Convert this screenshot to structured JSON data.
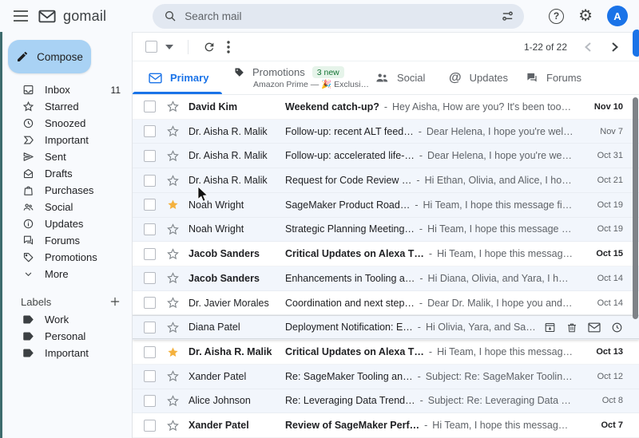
{
  "topbar": {
    "app_name": "gomail",
    "search_placeholder": "Search mail",
    "help_glyph": "?",
    "gear_glyph": "⚙",
    "avatar_letter": "A"
  },
  "toolbar": {
    "pagination": "1-22 of 22"
  },
  "sidebar": {
    "compose_label": "Compose",
    "items": [
      {
        "label": "Inbox",
        "count": "11",
        "icon": "inbox-icon"
      },
      {
        "label": "Starred",
        "icon": "star-icon"
      },
      {
        "label": "Snoozed",
        "icon": "clock-icon"
      },
      {
        "label": "Important",
        "icon": "important-icon"
      },
      {
        "label": "Sent",
        "icon": "send-icon"
      },
      {
        "label": "Drafts",
        "icon": "draft-icon"
      },
      {
        "label": "Purchases",
        "icon": "shopping-bag-icon"
      },
      {
        "label": "Social",
        "icon": "people-icon"
      },
      {
        "label": "Updates",
        "icon": "info-icon"
      },
      {
        "label": "Forums",
        "icon": "chat-icon"
      },
      {
        "label": "Promotions",
        "icon": "tag-icon"
      },
      {
        "label": "More",
        "icon": "chevron-down-icon"
      }
    ],
    "labels_header": "Labels",
    "labels": [
      "Work",
      "Personal",
      "Important"
    ]
  },
  "tabs": [
    {
      "label": "Primary",
      "active": true,
      "icon": "envelope-icon"
    },
    {
      "label": "Promotions",
      "badge": "3 new",
      "subtitle": "Amazon Prime — 🎉 Exclusi…",
      "icon": "tag-icon"
    },
    {
      "label": "Social",
      "icon": "people-icon"
    },
    {
      "label": "Updates",
      "icon_glyph": "@"
    },
    {
      "label": "Forums",
      "icon": "chat-icon"
    }
  ],
  "list": {
    "separator": "-"
  },
  "hover_actions": [
    "archive-icon",
    "trash-icon",
    "envelope-icon",
    "clock-icon"
  ],
  "emails": [
    {
      "sender": "David Kim",
      "subject": "Weekend catch-up?",
      "snippet": "Hey Aisha, How are you? It's been too long — I kee…",
      "date": "Nov 10",
      "unread": true,
      "starred": false,
      "tinted": false
    },
    {
      "sender": "Dr. Aisha R. Malik",
      "subject": "Follow-up: recent ALT feed…",
      "snippet": "Dear Helena, I hope you're well — and th…",
      "date": "Nov 7",
      "unread": false,
      "starred": false,
      "tinted": true
    },
    {
      "sender": "Dr. Aisha R. Malik",
      "subject": "Follow-up: accelerated life-…",
      "snippet": "Dear Helena, I hope you're well. Thank y…",
      "date": "Oct 31",
      "unread": false,
      "starred": false,
      "tinted": true
    },
    {
      "sender": "Dr. Aisha R. Malik",
      "subject": "Request for Code Review …",
      "snippet": "Hi Ethan, Olivia, and Alice, I hope this me…",
      "date": "Oct 21",
      "unread": false,
      "starred": false,
      "tinted": true
    },
    {
      "sender": "Noah Wright",
      "subject": "SageMaker Product Road…",
      "snippet": "Hi Team, I hope this message finds you w…",
      "date": "Oct 19",
      "unread": false,
      "starred": true,
      "tinted": true
    },
    {
      "sender": "Noah Wright",
      "subject": "Strategic Planning Meeting…",
      "snippet": "Hi Team, I hope this message finds you w…",
      "date": "Oct 19",
      "unread": false,
      "starred": false,
      "tinted": true
    },
    {
      "sender": "Jacob Sanders",
      "subject": "Critical Updates on Alexa T…",
      "snippet": "Hi Team, I hope this message finds you w…",
      "date": "Oct 15",
      "unread": true,
      "starred": false,
      "tinted": false
    },
    {
      "sender": "Jacob Sanders",
      "subject": "Enhancements in Tooling a…",
      "snippet": "Hi Diana, Olivia, and Yara, I hope this me…",
      "date": "Oct 14",
      "unread": false,
      "bold_sender": true,
      "starred": false,
      "tinted": true
    },
    {
      "sender": "Dr. Javier Morales",
      "subject": "Coordination and next step…",
      "snippet": "Dear Dr. Malik, I hope you and the SOFC …",
      "date": "Oct 14",
      "unread": false,
      "starred": false,
      "tinted": false
    },
    {
      "sender": "Diana Patel",
      "subject": "Deployment Notification: E…",
      "snippet": "Hi Olivia, Yara, and Samuel, I hope this m…",
      "date": "",
      "unread": false,
      "starred": false,
      "tinted": true,
      "hovered": true
    },
    {
      "sender": "Dr. Aisha R. Malik",
      "subject": "Critical Updates on Alexa T…",
      "snippet": "Hi Team, I hope this message finds you w…",
      "date": "Oct 13",
      "unread": true,
      "starred": true,
      "tinted": false
    },
    {
      "sender": "Xander Patel",
      "subject": "Re: SageMaker Tooling an…",
      "snippet": "Subject: Re: SageMaker Tooling and Infra…",
      "date": "Oct 12",
      "unread": false,
      "starred": false,
      "tinted": true
    },
    {
      "sender": "Alice Johnson",
      "subject": "Re: Leveraging Data Trend…",
      "snippet": "Subject: Re: Leveraging Data Trends to E…",
      "date": "Oct 8",
      "unread": false,
      "starred": false,
      "tinted": true
    },
    {
      "sender": "Xander Patel",
      "subject": "Review of SageMaker Perf…",
      "snippet": "Hi Team, I hope this message finds you w…",
      "date": "Oct 7",
      "unread": true,
      "starred": false,
      "tinted": false
    }
  ],
  "colors": {
    "accent": "#1a73e8",
    "compose_bg": "#a9d2f4",
    "badge_bg": "#e6f4ea",
    "badge_text": "#137333",
    "star": "#f4b13d",
    "read_row_bg": "#f2f6fc"
  }
}
